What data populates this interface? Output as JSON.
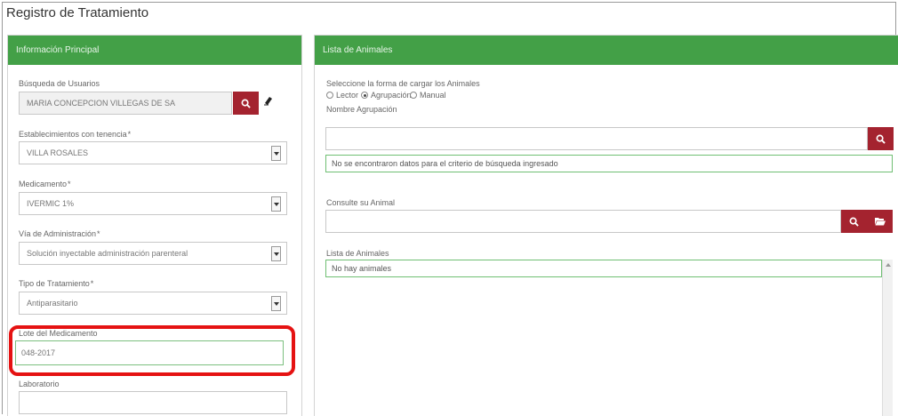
{
  "page": {
    "title": "Registro de Tratamiento"
  },
  "left_panel": {
    "header": "Información Principal",
    "busqueda": {
      "label": "Búsqueda de Usuarios",
      "value": "MARIA CONCEPCION VILLEGAS DE SA"
    },
    "establecimientos": {
      "label": "Establecimientos con tenencia",
      "required": "*",
      "value": "VILLA ROSALES"
    },
    "medicamento": {
      "label": "Medicamento",
      "required": "*",
      "value": "IVERMIC 1%"
    },
    "via": {
      "label": "Vía de Administración",
      "required": "*",
      "value": "Solución inyectable administración parenteral"
    },
    "tipo": {
      "label": "Tipo de Tratamiento",
      "required": "*",
      "value": "Antiparasitario"
    },
    "lote": {
      "label": "Lote del Medicamento",
      "value": "048-2017"
    },
    "laboratorio": {
      "label": "Laboratorio",
      "value": ""
    }
  },
  "right_panel": {
    "header": "Lista de Animales",
    "forma_label": "Seleccione la forma de cargar los Animales",
    "radios": [
      {
        "label": "Lector",
        "checked": false
      },
      {
        "label": "Agrupación",
        "checked": true
      },
      {
        "label": "Manual",
        "checked": false
      }
    ],
    "agrupacion": {
      "label": "Nombre Agrupación",
      "value": ""
    },
    "agrupacion_msg": "No se encontraron datos para el criterio de búsqueda ingresado",
    "consulte": {
      "label": "Consulte su Animal",
      "value": ""
    },
    "lista": {
      "label": "Lista de Animales",
      "empty_msg": "No hay animales"
    }
  },
  "colors": {
    "panel_header": "#43a047",
    "button": "#a4232f",
    "highlight": "#e51212"
  },
  "icons": [
    "search-icon",
    "eraser-icon",
    "folder-open-icon",
    "chevron-down-icon"
  ]
}
